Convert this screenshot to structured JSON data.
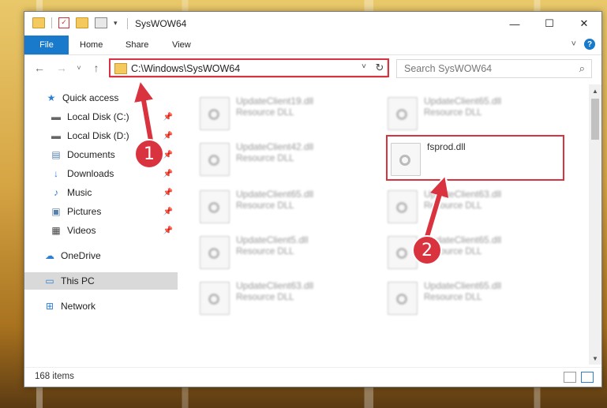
{
  "window": {
    "title": "SysWOW64",
    "controls": {
      "minimize": "—",
      "maximize": "☐",
      "close": "✕"
    }
  },
  "ribbon": {
    "tabs": [
      "File",
      "Home",
      "Share",
      "View"
    ],
    "expand_icon": "˅",
    "help_icon": "?"
  },
  "navigation": {
    "back": "←",
    "forward": "→",
    "recent": "˅",
    "up": "↑",
    "address": "C:\\Windows\\SysWOW64",
    "address_dropdown": "˅",
    "refresh": "↻",
    "search_placeholder": "Search SysWOW64",
    "search_icon": "⌕"
  },
  "sidebar": {
    "items": [
      {
        "label": "Quick access",
        "icon": "star-icon",
        "glyph": "★",
        "pinned": false
      },
      {
        "label": "Local Disk (C:)",
        "icon": "drive-icon",
        "glyph": "▬",
        "pinned": true
      },
      {
        "label": "Local Disk (D:)",
        "icon": "drive-icon",
        "glyph": "▬",
        "pinned": true
      },
      {
        "label": "Documents",
        "icon": "document-icon",
        "glyph": "▤",
        "pinned": true
      },
      {
        "label": "Downloads",
        "icon": "download-icon",
        "glyph": "↓",
        "pinned": true
      },
      {
        "label": "Music",
        "icon": "music-icon",
        "glyph": "♪",
        "pinned": true
      },
      {
        "label": "Pictures",
        "icon": "picture-icon",
        "glyph": "▣",
        "pinned": true
      },
      {
        "label": "Videos",
        "icon": "video-icon",
        "glyph": "▦",
        "pinned": true
      },
      {
        "label": "OneDrive",
        "icon": "cloud-icon",
        "glyph": "☁",
        "pinned": false
      },
      {
        "label": "This PC",
        "icon": "computer-icon",
        "glyph": "▭",
        "pinned": false,
        "selected": true
      },
      {
        "label": "Network",
        "icon": "network-icon",
        "glyph": "⊞",
        "pinned": false
      }
    ]
  },
  "files": [
    {
      "name": "UpdateClient19.dll",
      "type": "Resource DLL",
      "blurred": true
    },
    {
      "name": "UpdateClient65.dll",
      "type": "Resource DLL",
      "blurred": true
    },
    {
      "name": "UpdateClient42.dll",
      "type": "Resource DLL",
      "blurred": true
    },
    {
      "name": "fsprod.dll",
      "type": "",
      "blurred": false,
      "highlighted": true
    },
    {
      "name": "UpdateClient65.dll",
      "type": "Resource DLL",
      "blurred": true
    },
    {
      "name": "UpdateClient63.dll",
      "type": "Resource DLL",
      "blurred": true
    },
    {
      "name": "UpdateClient5.dll",
      "type": "Resource DLL",
      "blurred": true
    },
    {
      "name": "UpdateClient65.dll",
      "type": "Resource DLL",
      "blurred": true
    },
    {
      "name": "UpdateClient63.dll",
      "type": "Resource DLL",
      "blurred": true
    },
    {
      "name": "UpdateClient65.dll",
      "type": "Resource DLL",
      "blurred": true
    }
  ],
  "status": {
    "item_count": "168 items"
  },
  "annotations": {
    "marker1": "1",
    "marker2": "2",
    "color": "#d9333f"
  }
}
